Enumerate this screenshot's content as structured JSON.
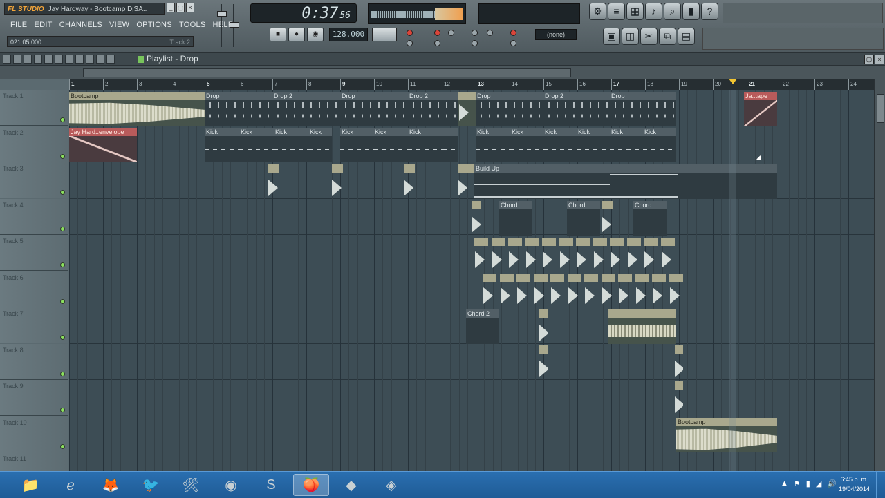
{
  "app": {
    "logo": "FL STUDIO",
    "window_title": "Jay Hardway - Bootcamp DjSA..",
    "window_buttons": [
      "_",
      "▢",
      "×"
    ],
    "menu": [
      "FILE",
      "EDIT",
      "CHANNELS",
      "VIEW",
      "OPTIONS",
      "TOOLS",
      "HELP"
    ],
    "position_readout": "021:05:000",
    "position_target": "Track 2",
    "time_display": "0:37",
    "time_display_small": "56",
    "bpm": "128.000",
    "pattern_selector": "(none)",
    "toolbar_icons": [
      "settings-icon",
      "mixer-icon",
      "channel-rack-icon",
      "piano-roll-icon",
      "browser-icon",
      "plugin-icon",
      "help-icon"
    ],
    "toolbar_icons2": [
      "save-icon",
      "render-icon",
      "cut-icon",
      "copy-icon",
      "paste-icon"
    ]
  },
  "playlist": {
    "title": "Playlist - Drop",
    "bars": [
      "1",
      "2",
      "3",
      "4",
      "5",
      "6",
      "7",
      "8",
      "9",
      "10",
      "11",
      "12",
      "13",
      "14",
      "15",
      "16",
      "17",
      "18",
      "19",
      "20",
      "21",
      "22",
      "23",
      "24"
    ],
    "tracks": [
      "Track 1",
      "Track 2",
      "Track 3",
      "Track 4",
      "Track 5",
      "Track 6",
      "Track 7",
      "Track 8",
      "Track 9",
      "Track 10",
      "Track 11"
    ],
    "clips": {
      "bootcamp": "Bootcamp",
      "drop": "Drop",
      "drop2": "Drop 2",
      "jay_env": "Jay Hard..envelope",
      "jay_tape": "Ja..tape",
      "kick": "Kick",
      "build_up": "Build Up",
      "chord": "Chord",
      "chord2": "Chord 2"
    }
  },
  "taskbar": {
    "apps": [
      "explorer-icon",
      "ie-icon",
      "firefox-icon",
      "bird-icon",
      "tools-icon",
      "chrome-icon",
      "skype-icon",
      "fl-studio-icon",
      "app-icon",
      "app2-icon"
    ],
    "time": "6:45 p. m.",
    "date": "19/04/2014"
  },
  "colors": {
    "grid": "#3d4d55",
    "audio_clip": "#a9a88d",
    "automation_clip": "#b85b5b",
    "pattern_clip": "#525f66",
    "playhead_marker": "#f2c531"
  }
}
